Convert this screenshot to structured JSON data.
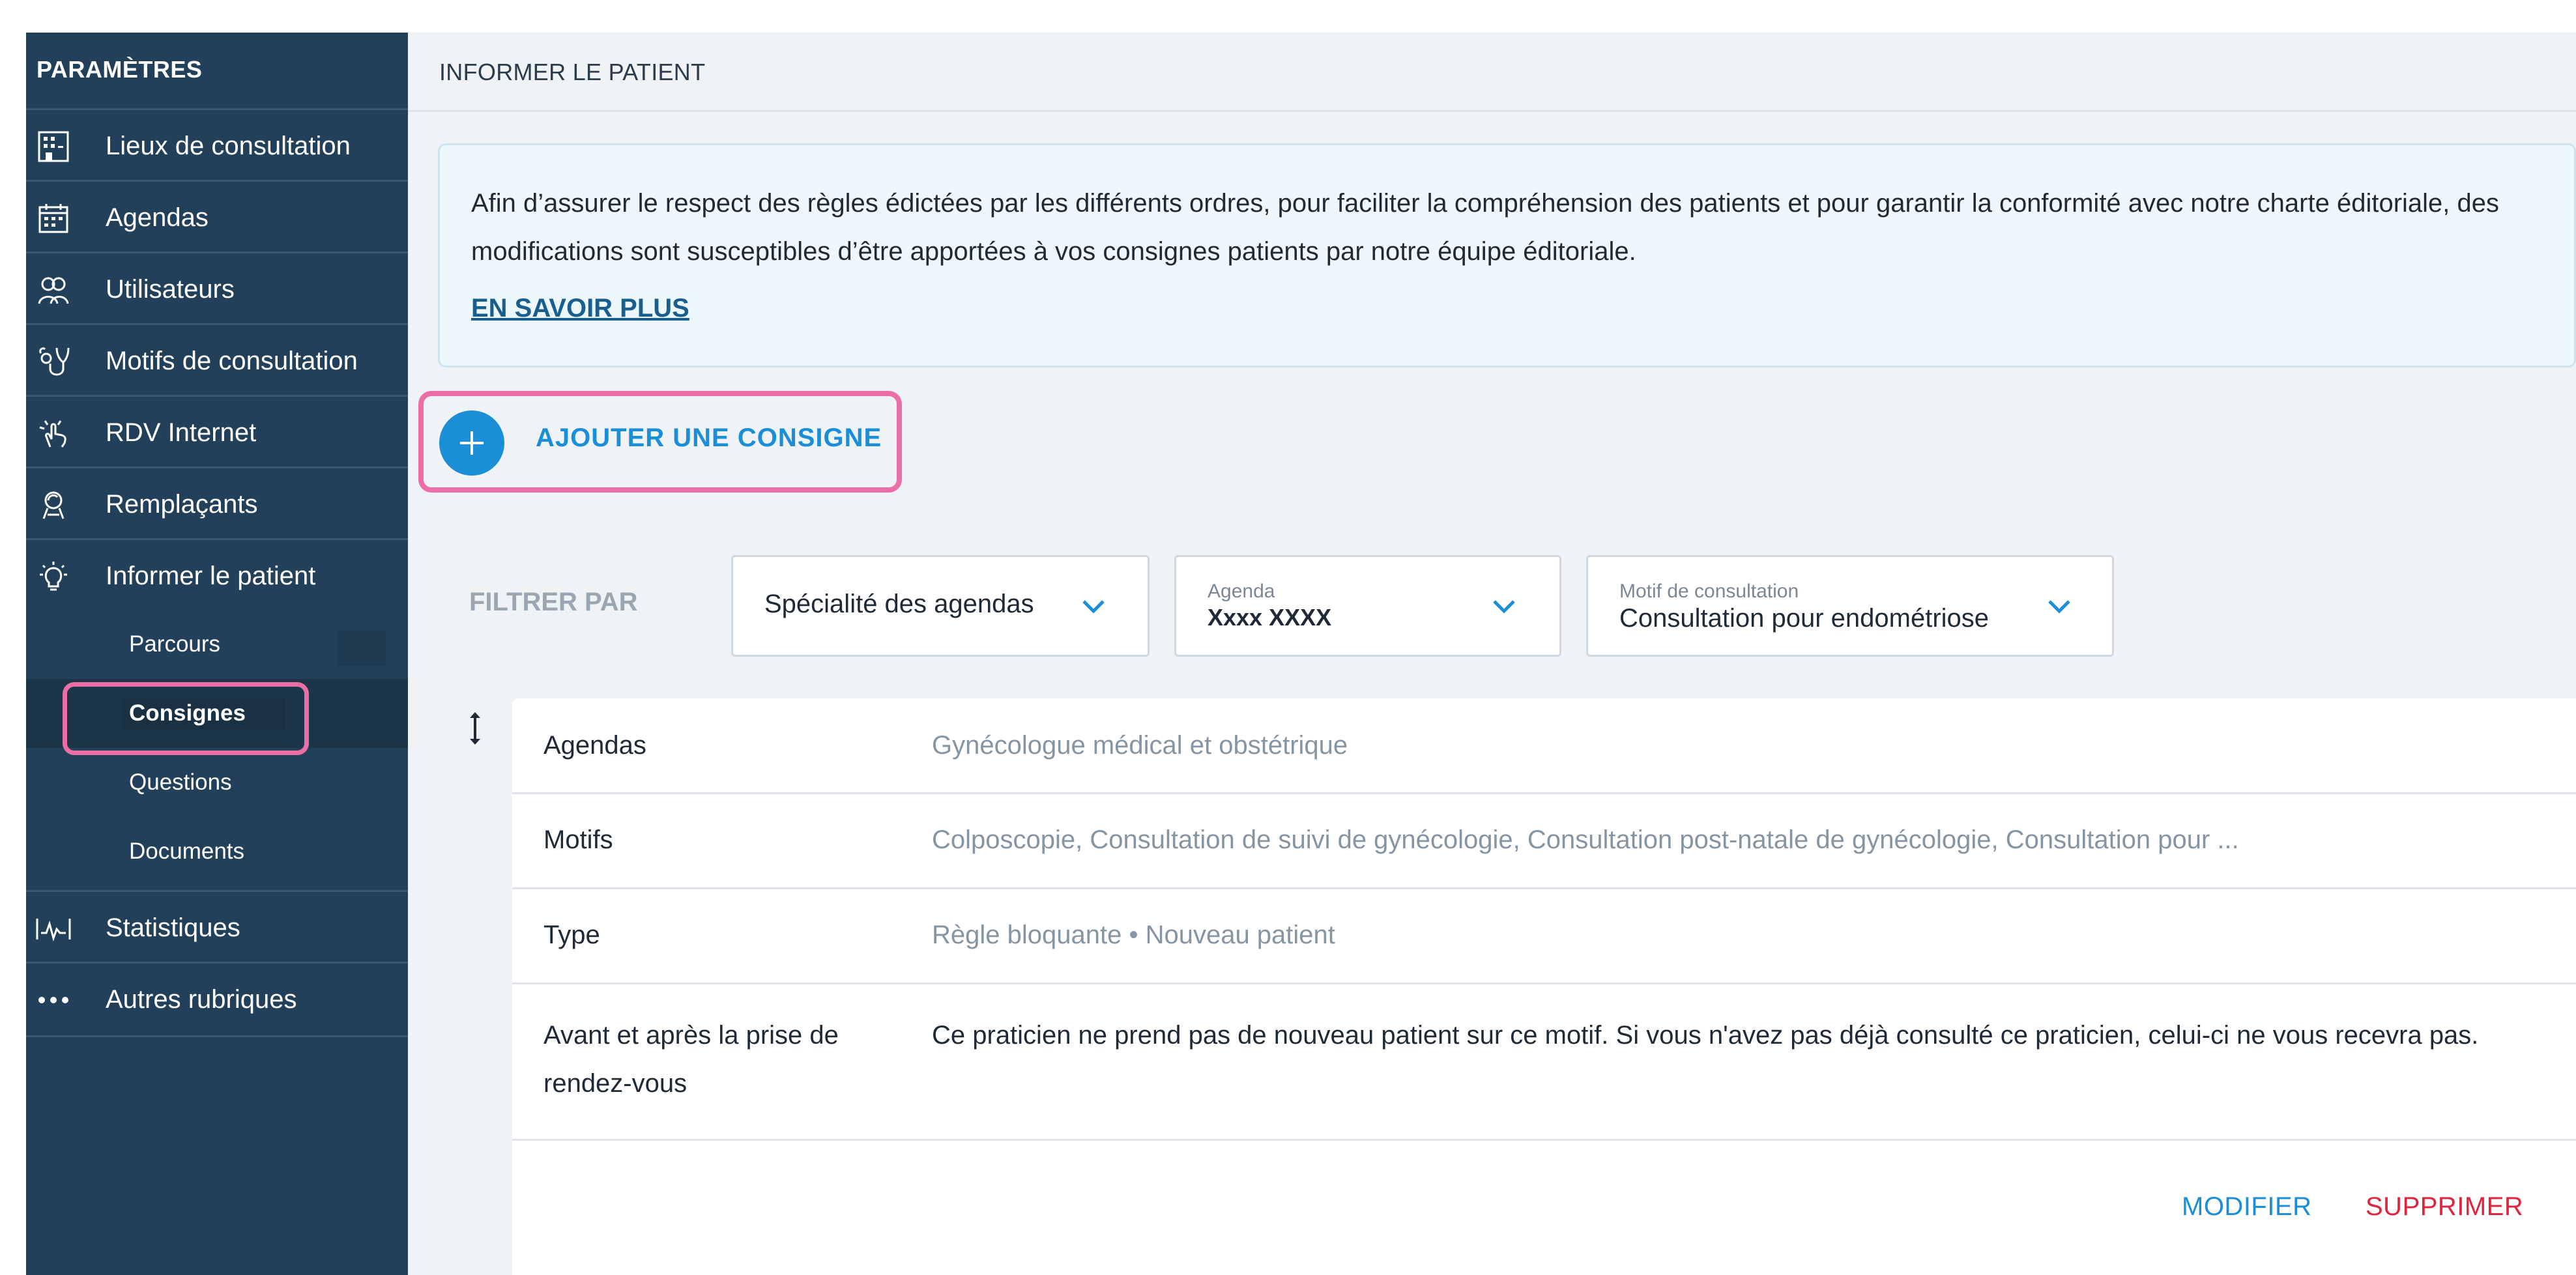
{
  "sidebar": {
    "title": "PARAMÈTRES",
    "items": [
      {
        "label": "Lieux de consultation",
        "icon": "building-icon"
      },
      {
        "label": "Agendas",
        "icon": "calendar-icon"
      },
      {
        "label": "Utilisateurs",
        "icon": "users-icon"
      },
      {
        "label": "Motifs de consultation",
        "icon": "stethoscope-icon"
      },
      {
        "label": "RDV Internet",
        "icon": "click-hand-icon"
      },
      {
        "label": "Remplaçants",
        "icon": "replacement-icon"
      },
      {
        "label": "Informer le patient",
        "icon": "lightbulb-icon"
      },
      {
        "label": "Statistiques",
        "icon": "chart-pulse-icon"
      },
      {
        "label": "Autres rubriques",
        "icon": "more-dots-icon"
      }
    ],
    "subitems": [
      {
        "label": "Parcours"
      },
      {
        "label": "Consignes",
        "active": true
      },
      {
        "label": "Questions"
      },
      {
        "label": "Documents"
      }
    ]
  },
  "header": {
    "title": "INFORMER LE PATIENT"
  },
  "info": {
    "text": "Afin d’assurer le respect des règles édictées par les différents ordres, pour faciliter la compréhension des patients et pour garantir la conformité avec notre charte éditoriale, des modifications sont susceptibles d’être apportées à vos consignes patients par notre équipe éditoriale.",
    "link": "EN SAVOIR PLUS"
  },
  "add_button": {
    "label": "AJOUTER UNE CONSIGNE",
    "icon": "plus-icon"
  },
  "filters": {
    "label": "FILTRER PAR",
    "specialite": {
      "value": "Spécialité des agendas"
    },
    "agenda": {
      "label": "Agenda",
      "value": "Xxxx XXXX"
    },
    "motif": {
      "label": "Motif de consultation",
      "value": "Consultation pour endométriose"
    }
  },
  "consigne": {
    "rows": [
      {
        "key": "Agendas",
        "value": "Gynécologue médical et obstétrique"
      },
      {
        "key": "Motifs",
        "value": "Colposcopie, Consultation de suivi de gynécologie, Consultation post-natale de gynécologie, Consultation pour ..."
      },
      {
        "key": "Type",
        "value": "Règle bloquante • Nouveau patient"
      },
      {
        "key": "Avant et après la prise de rendez-vous",
        "value": "Ce praticien ne prend pas de nouveau patient sur ce motif. Si vous n'avez pas déjà consulté ce praticien, celui-ci ne vous recevra pas."
      }
    ],
    "actions": {
      "edit": "MODIFIER",
      "delete": "SUPPRIMER"
    }
  },
  "colors": {
    "sidebar_bg": "#23405a",
    "accent_blue": "#1b8ed8",
    "danger_red": "#e0243d",
    "highlight_pink": "#ec6ea6"
  }
}
